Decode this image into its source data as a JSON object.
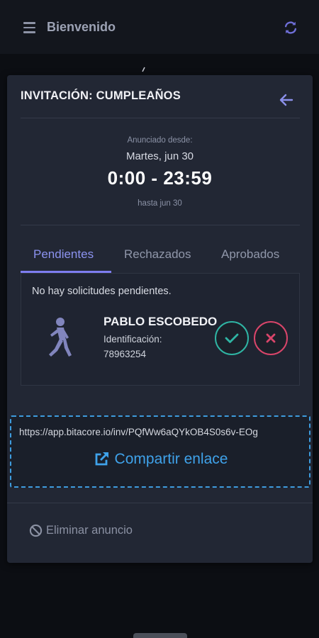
{
  "header": {
    "title": "Bienvenido",
    "menu_icon": "menu-icon",
    "refresh_icon": "refresh-icon"
  },
  "card": {
    "title": "INVITACIÓN: CUMPLEAÑOS",
    "back_icon": "arrow-left-icon",
    "schedule": {
      "since_label": "Anunciado desde:",
      "date": "Martes, jun 30",
      "time_range": "0:00 - 23:59",
      "until": "hasta jun 30"
    },
    "tabs": [
      {
        "label": "Pendientes",
        "active": true
      },
      {
        "label": "Rechazados",
        "active": false
      },
      {
        "label": "Aprobados",
        "active": false
      }
    ],
    "requests": {
      "empty_message": "No hay solicitudes pendientes.",
      "person": {
        "name": "PABLO ESCOBEDO",
        "id_label": "Identificación:",
        "id_value": "78963254",
        "icon": "walking-person-icon"
      }
    },
    "share": {
      "url": "https://app.bitacore.io/inv/PQfWw6aQYkOB4S0s6v-EOg",
      "label": "Compartir enlace"
    },
    "delete_label": "Eliminar anuncio"
  },
  "colors": {
    "accent": "#8c93f0",
    "approve": "#2fb5a4",
    "reject": "#d9456a",
    "share": "#3fa2ea",
    "card_bg": "#222734",
    "page_bg": "#0c0e13"
  }
}
